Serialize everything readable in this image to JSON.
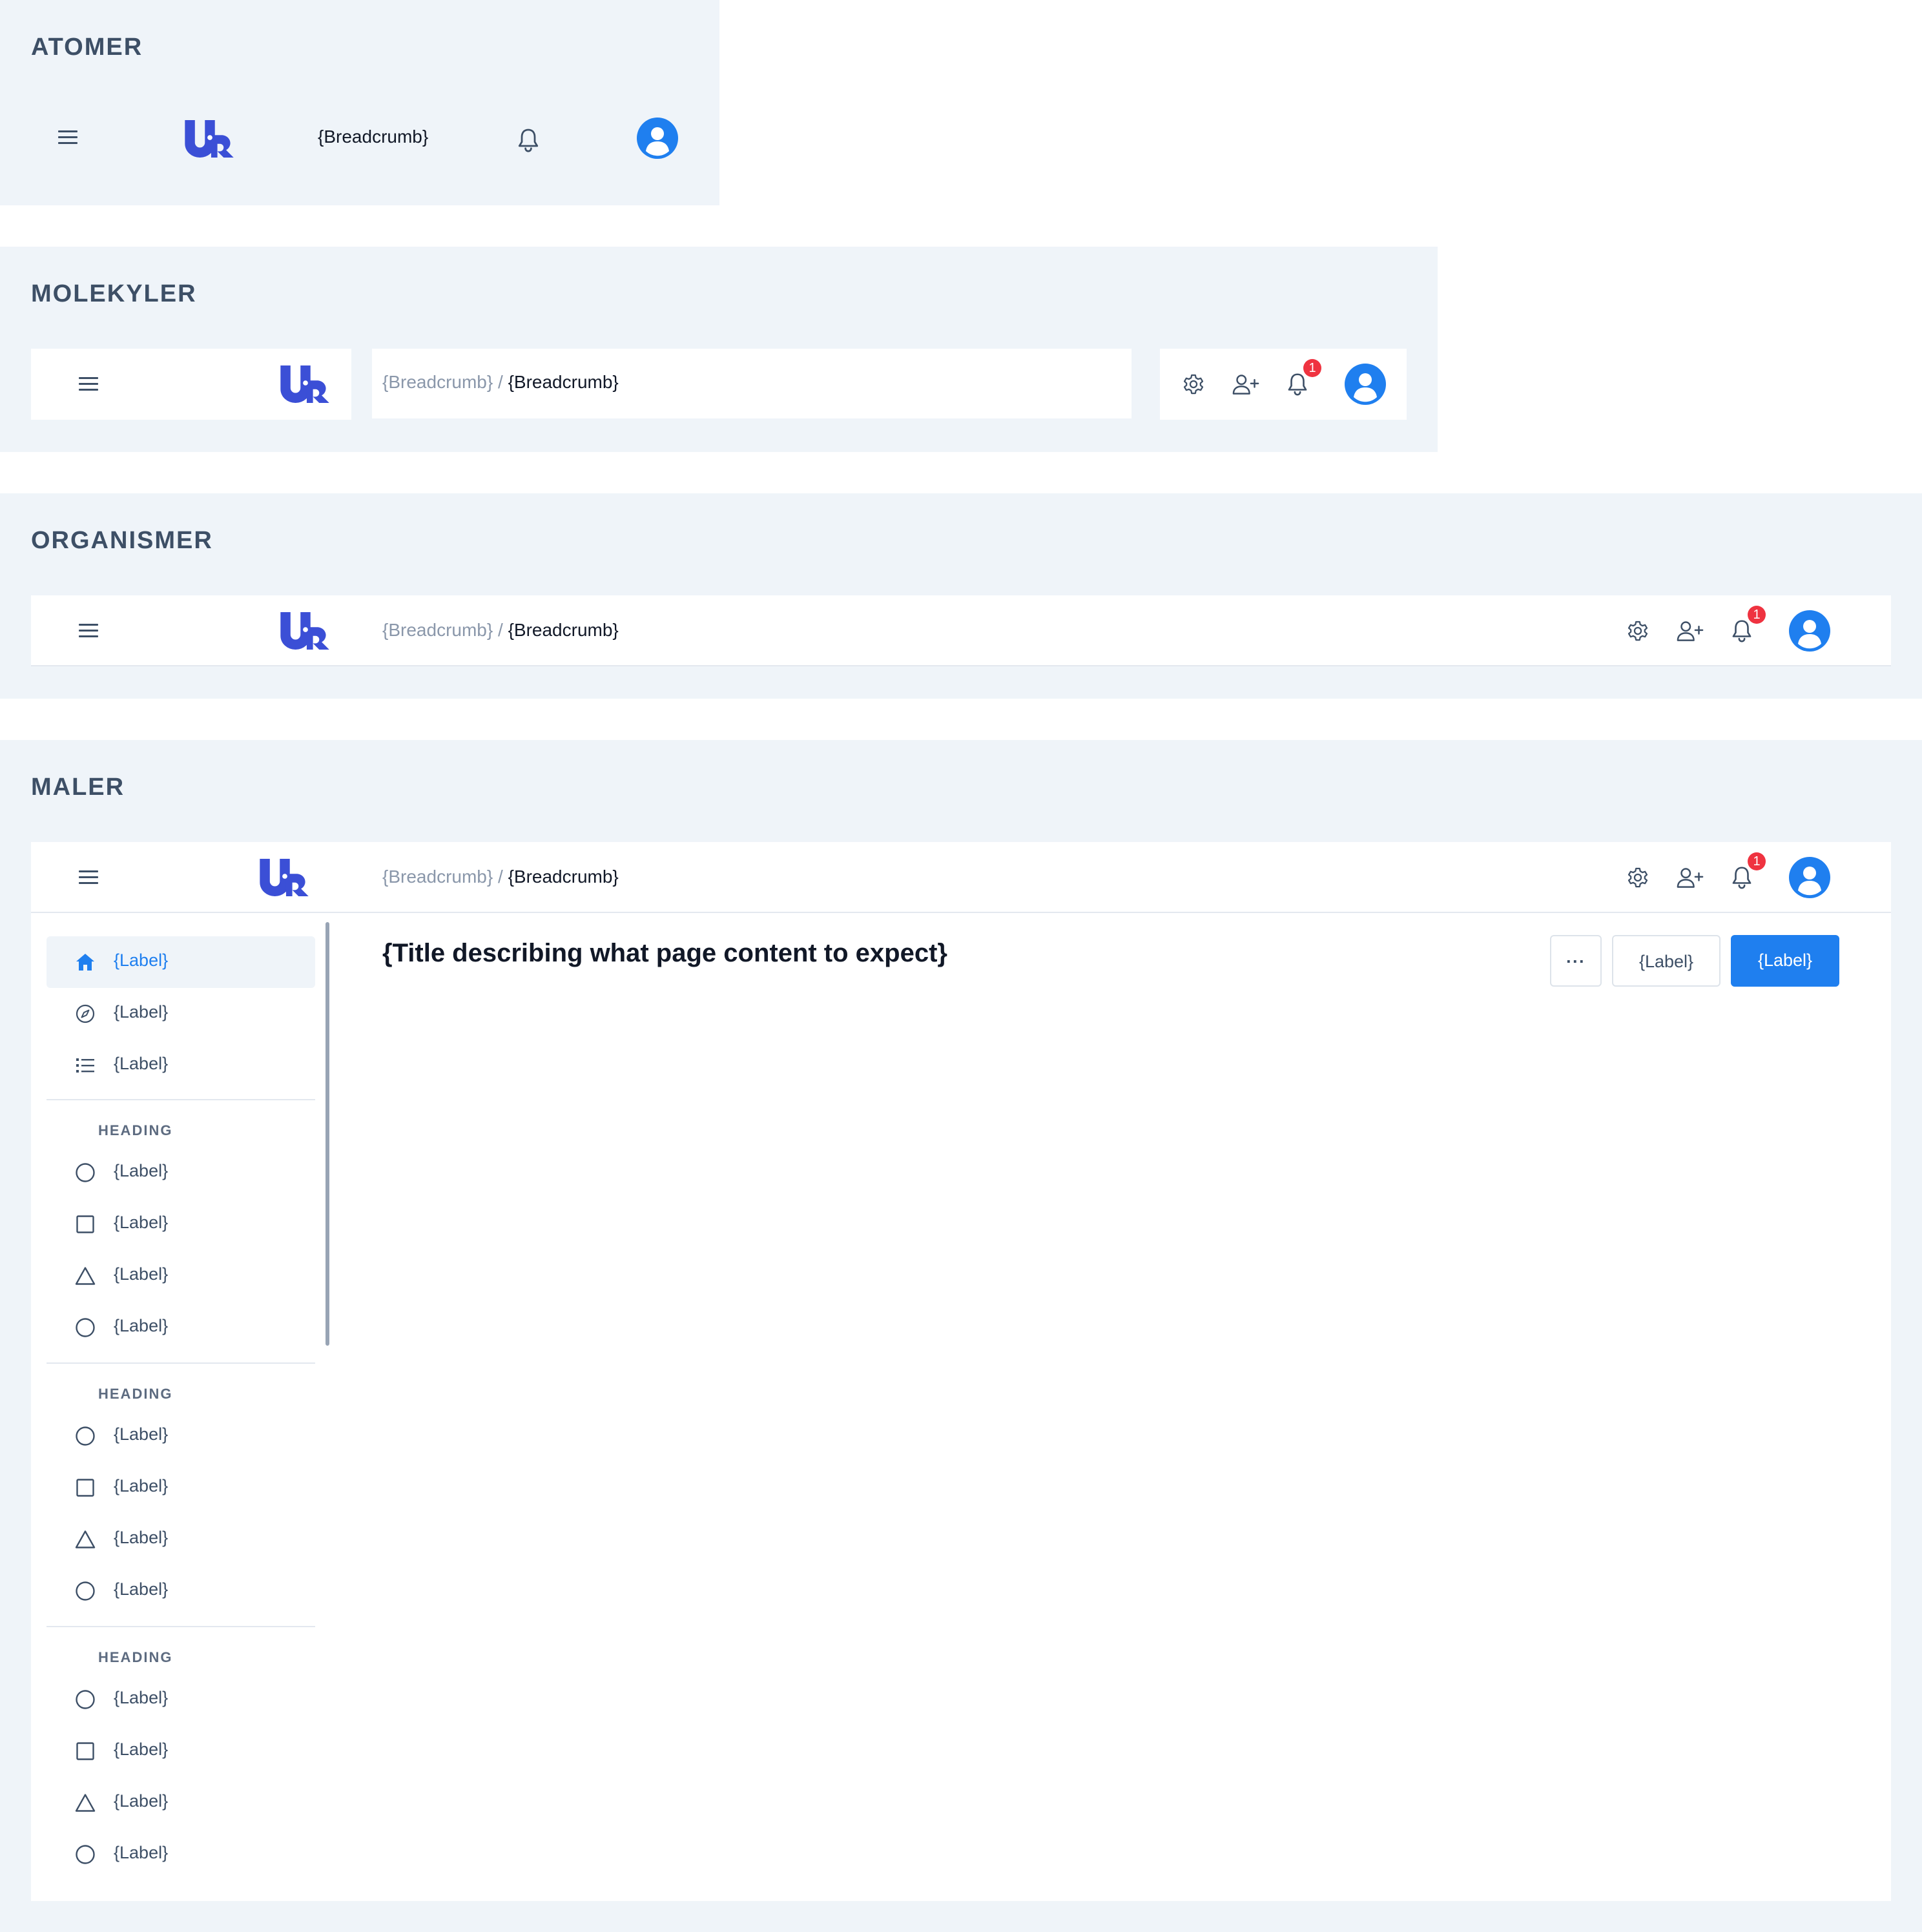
{
  "colors": {
    "panel": "#eff4f9",
    "primary": "#1f7fef",
    "logo": "#3b4fd6",
    "badge": "#ef3340",
    "text_muted": "#8a97aa"
  },
  "sections": {
    "atomer": {
      "title": "ATOMER",
      "breadcrumb": "{Breadcrumb}"
    },
    "molekyler": {
      "title": "MOLEKYLER",
      "breadcrumb_parent": "{Breadcrumb}",
      "separator": "/",
      "breadcrumb_current": "{Breadcrumb}",
      "notification_count": "1"
    },
    "organismer": {
      "title": "ORGANISMER",
      "breadcrumb_parent": "{Breadcrumb}",
      "separator": "/",
      "breadcrumb_current": "{Breadcrumb}",
      "notification_count": "1"
    },
    "maler": {
      "title": "MALER",
      "breadcrumb_parent": "{Breadcrumb}",
      "separator": "/",
      "breadcrumb_current": "{Breadcrumb}",
      "notification_count": "1",
      "page_title": "{Title describing what page content to expect}",
      "more_button": "···",
      "secondary_button": "{Label}",
      "primary_button": "{Label}",
      "nav_top": [
        {
          "icon": "home-icon",
          "label": "{Label}",
          "active": true
        },
        {
          "icon": "compass-icon",
          "label": "{Label}"
        },
        {
          "icon": "list-icon",
          "label": "{Label}"
        }
      ],
      "nav_groups": [
        {
          "heading": "HEADING",
          "items": [
            {
              "icon": "circle-icon",
              "label": "{Label}"
            },
            {
              "icon": "square-icon",
              "label": "{Label}"
            },
            {
              "icon": "triangle-icon",
              "label": "{Label}"
            },
            {
              "icon": "circle-icon",
              "label": "{Label}"
            }
          ]
        },
        {
          "heading": "HEADING",
          "items": [
            {
              "icon": "circle-icon",
              "label": "{Label}"
            },
            {
              "icon": "square-icon",
              "label": "{Label}"
            },
            {
              "icon": "triangle-icon",
              "label": "{Label}"
            },
            {
              "icon": "circle-icon",
              "label": "{Label}"
            }
          ]
        },
        {
          "heading": "HEADING",
          "items": [
            {
              "icon": "circle-icon",
              "label": "{Label}"
            },
            {
              "icon": "square-icon",
              "label": "{Label}"
            },
            {
              "icon": "triangle-icon",
              "label": "{Label}"
            },
            {
              "icon": "circle-icon",
              "label": "{Label}"
            }
          ]
        }
      ]
    }
  }
}
